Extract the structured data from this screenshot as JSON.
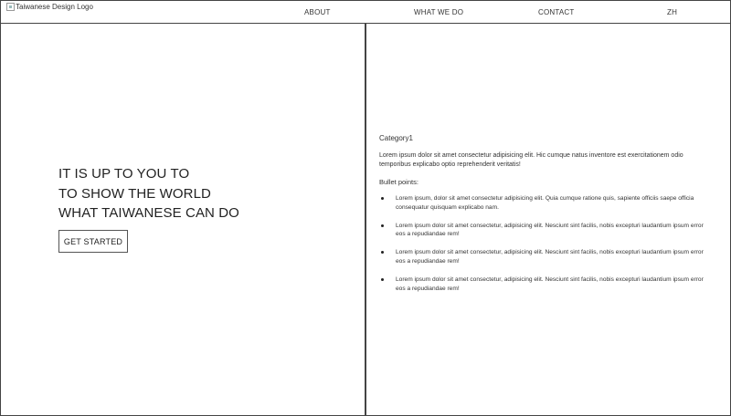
{
  "header": {
    "logo_alt": "Taiwanese Design Logo",
    "nav": [
      {
        "label": "ABOUT"
      },
      {
        "label": "WHAT WE DO"
      },
      {
        "label": "CONTACT"
      },
      {
        "label": "ZH"
      }
    ]
  },
  "hero": {
    "lines": [
      "IT IS UP TO YOU TO",
      "TO SHOW THE WORLD",
      "WHAT TAIWANESE CAN DO"
    ],
    "cta_label": "GET STARTED"
  },
  "content": {
    "category": "Category1",
    "description": "Lorem ipsum dolor sit amet consectetur adipisicing elit. Hic cumque natus inventore est exercitationem odio temporibus explicabo optio reprehenderit veritatis!",
    "bullets_heading": "Bullet points:",
    "bullets": [
      "Lorem ipsum, dolor sit amet consectetur adipisicing elit. Quia cumque ratione quis, sapiente officiis saepe officia consequatur quisquam explicabo nam.",
      "Lorem ipsum dolor sit amet consectetur, adipisicing elit. Nesciunt sint facilis, nobis excepturi laudantium ipsum error eos a repudiandae rem!",
      "Lorem ipsum dolor sit amet consectetur, adipisicing elit. Nesciunt sint facilis, nobis excepturi laudantium ipsum error eos a repudiandae rem!",
      "Lorem ipsum dolor sit amet consectetur, adipisicing elit. Nesciunt sint facilis, nobis excepturi laudantium ipsum error eos a repudiandae rem!"
    ]
  }
}
